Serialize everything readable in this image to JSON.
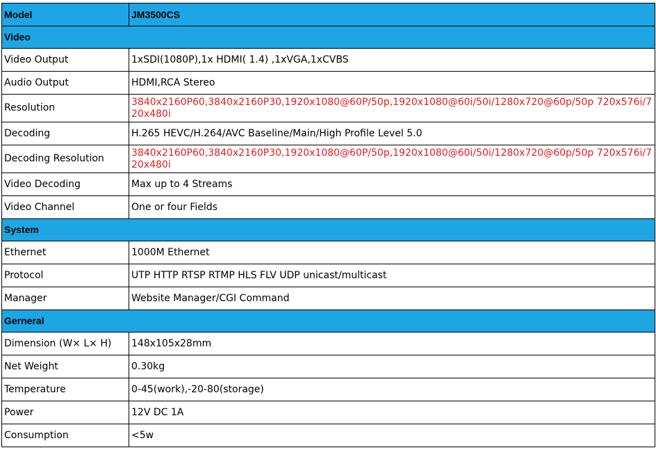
{
  "header": {
    "label": "Model",
    "value": "JM3500CS"
  },
  "sections": [
    {
      "title": "Video",
      "rows": [
        {
          "label": "Video Output",
          "value": "1xSDI(1080P),1x HDMI( 1.4) ,1xVGA,1xCVBS"
        },
        {
          "label": "Audio Output",
          "value": "HDMI,RCA Stereo"
        },
        {
          "label": "Resolution",
          "value": "3840x2160P60,3840x2160P30,1920x1080@60P/50p,1920x1080@60i/50i/1280x720@60p/50p 720x576i/720x480i",
          "highlight": "#e41c1c"
        },
        {
          "label": "Decoding",
          "value": "H.265 HEVC/H.264/AVC Baseline/Main/High Profile Level 5.0"
        },
        {
          "label": "Decoding Resolution",
          "value": "3840x2160P60,3840x2160P30,1920x1080@60P/50p,1920x1080@60i/50i/1280x720@60p/50p 720x576i/720x480i",
          "highlight": "#e41c1c"
        },
        {
          "label": "Video Decoding",
          "value": "Max up to 4 Streams"
        },
        {
          "label": "Video Channel",
          "value": "One or four Fields"
        }
      ]
    },
    {
      "title": "System",
      "rows": [
        {
          "label": "Ethernet",
          "value": "1000M Ethernet"
        },
        {
          "label": "Protocol",
          "value": "UTP HTTP RTSP RTMP HLS FLV UDP unicast/multicast"
        },
        {
          "label": "Manager",
          "value": "Website Manager/CGI Command"
        }
      ]
    },
    {
      "title": "Gerneral",
      "rows": [
        {
          "label": "Dimension (W× L× H)",
          "value": "148x105x28mm"
        },
        {
          "label": "Net Weight",
          "value": "0.30kg"
        },
        {
          "label": "Temperature",
          "value": "0-45(work),-20-80(storage)"
        },
        {
          "label": "Power",
          "value": "12V DC 1A"
        },
        {
          "label": "Consumption",
          "value": "<5w"
        }
      ]
    }
  ],
  "colors": {
    "header_bg": "#1ea6e4",
    "highlight_text": "#e41c1c",
    "border": "#000000"
  }
}
